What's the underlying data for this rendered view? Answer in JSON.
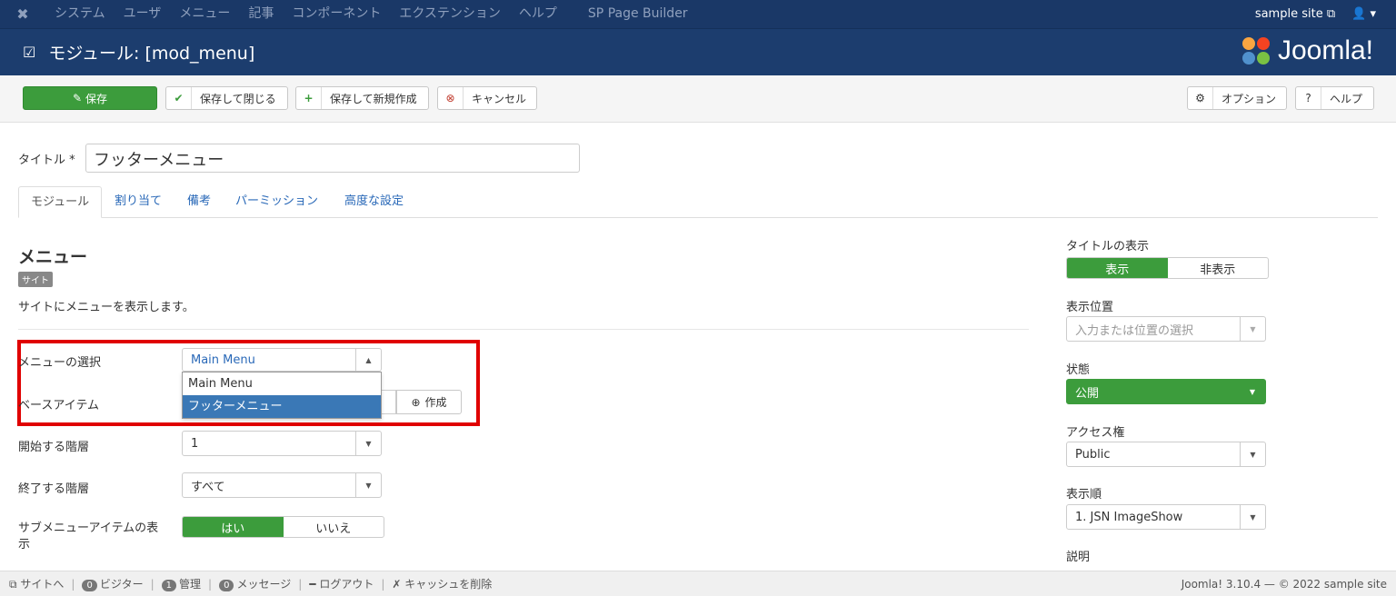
{
  "topbar": {
    "menu": [
      "システム",
      "ユーザ",
      "メニュー",
      "記事",
      "コンポーネント",
      "エクステンション",
      "ヘルプ",
      "SP Page Builder"
    ],
    "site": "sample site",
    "user_icon": "user-icon"
  },
  "header": {
    "title": "モジュール: [mod_menu]",
    "brand": "Joomla!"
  },
  "toolbar": {
    "save": "保存",
    "save_close": "保存して閉じる",
    "save_new": "保存して新規作成",
    "cancel": "キャンセル",
    "options": "オプション",
    "help": "ヘルプ"
  },
  "title_field": {
    "label": "タイトル *",
    "value": "フッターメニュー"
  },
  "tabs": [
    "モジュール",
    "割り当て",
    "備考",
    "パーミッション",
    "高度な設定"
  ],
  "module": {
    "heading": "メニュー",
    "badge": "サイト",
    "description": "サイトにメニューを表示します。"
  },
  "fields": {
    "menu_select_label": "メニューの選択",
    "menu_select_value": "Main Menu",
    "menu_options": [
      "Main Menu",
      "フッターメニュー"
    ],
    "base_item_label": "ベースアイテム",
    "create": "作成",
    "start_level_label": "開始する階層",
    "start_level_value": "1",
    "end_level_label": "終了する階層",
    "end_level_value": "すべて",
    "submenu_label": "サブメニューアイテムの表示",
    "yes": "はい",
    "no": "いいえ"
  },
  "side": {
    "show_title_label": "タイトルの表示",
    "show": "表示",
    "hide": "非表示",
    "position_label": "表示位置",
    "position_placeholder": "入力または位置の選択",
    "status_label": "状態",
    "status_value": "公開",
    "access_label": "アクセス権",
    "access_value": "Public",
    "order_label": "表示順",
    "order_value": "1. JSN ImageShow",
    "note_label": "説明"
  },
  "footer": {
    "site": "サイトへ",
    "visitors": "0",
    "visitors_label": "ビジター",
    "admin": "1",
    "admin_label": "管理",
    "messages": "0",
    "messages_label": "メッセージ",
    "logout": "ログアウト",
    "clear_cache": "キャッシュを削除",
    "version": "Joomla! 3.10.4 — © 2022 sample site"
  },
  "colors": {
    "navy": "#1a3867",
    "green": "#3c9c3c",
    "highlight": "#e00000",
    "selected": "#3a78b6"
  }
}
